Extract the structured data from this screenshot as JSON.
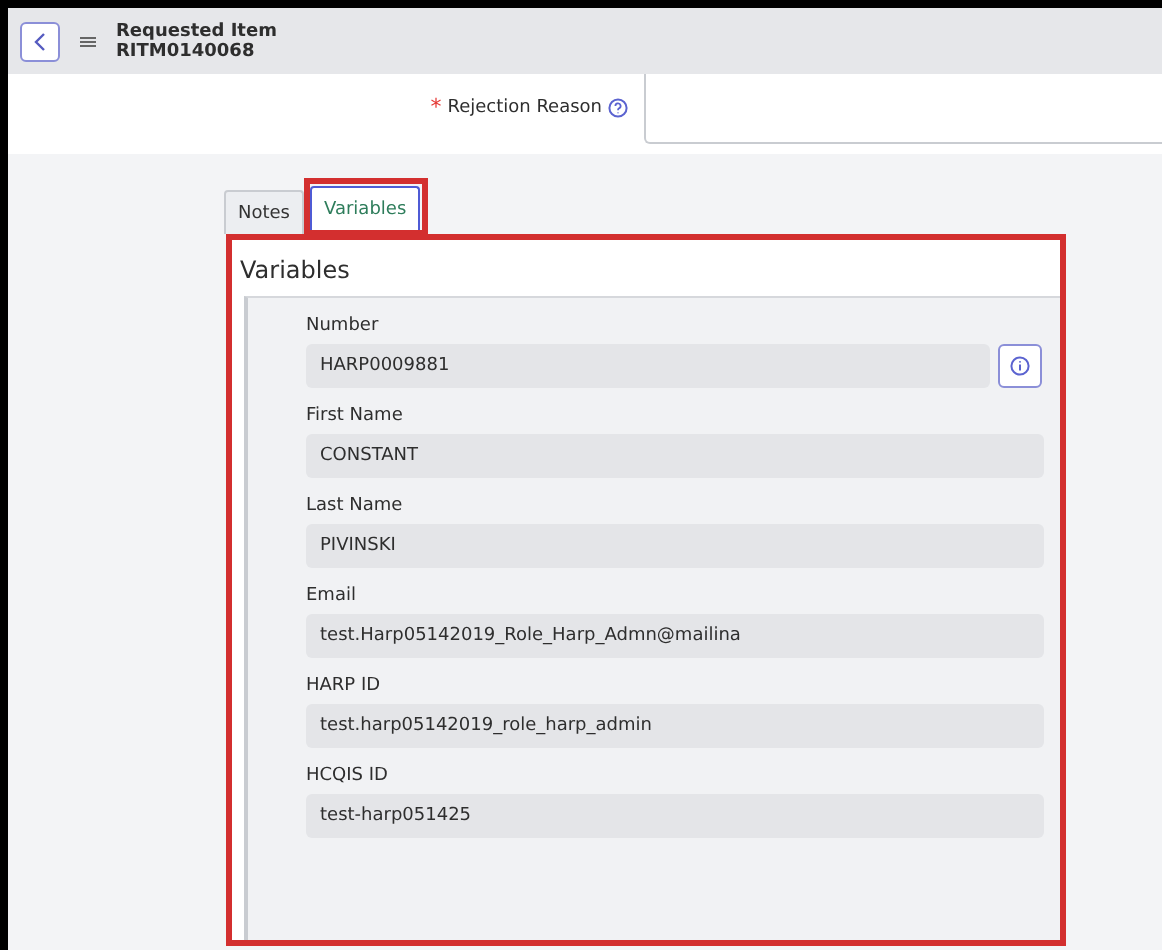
{
  "header": {
    "title": "Requested Item",
    "number": "RITM0140068"
  },
  "rejection_reason": {
    "label": "Rejection Reason",
    "required_mark": "*"
  },
  "tabs": [
    {
      "label": "Notes",
      "selected": false
    },
    {
      "label": "Variables",
      "selected": true
    }
  ],
  "variables": {
    "heading": "Variables",
    "fields": [
      {
        "label": "Number",
        "value": "HARP0009881",
        "kind": "reference"
      },
      {
        "label": "First Name",
        "value": "CONSTANT",
        "kind": "text"
      },
      {
        "label": "Last Name",
        "value": "PIVINSKI",
        "kind": "text"
      },
      {
        "label": "Email",
        "value": "test.Harp05142019_Role_Harp_Admn@mailina",
        "kind": "text"
      },
      {
        "label": "HARP ID",
        "value": "test.harp05142019_role_harp_admin",
        "kind": "text"
      },
      {
        "label": "HCQIS ID",
        "value": "test-harp051425",
        "kind": "text"
      }
    ]
  }
}
